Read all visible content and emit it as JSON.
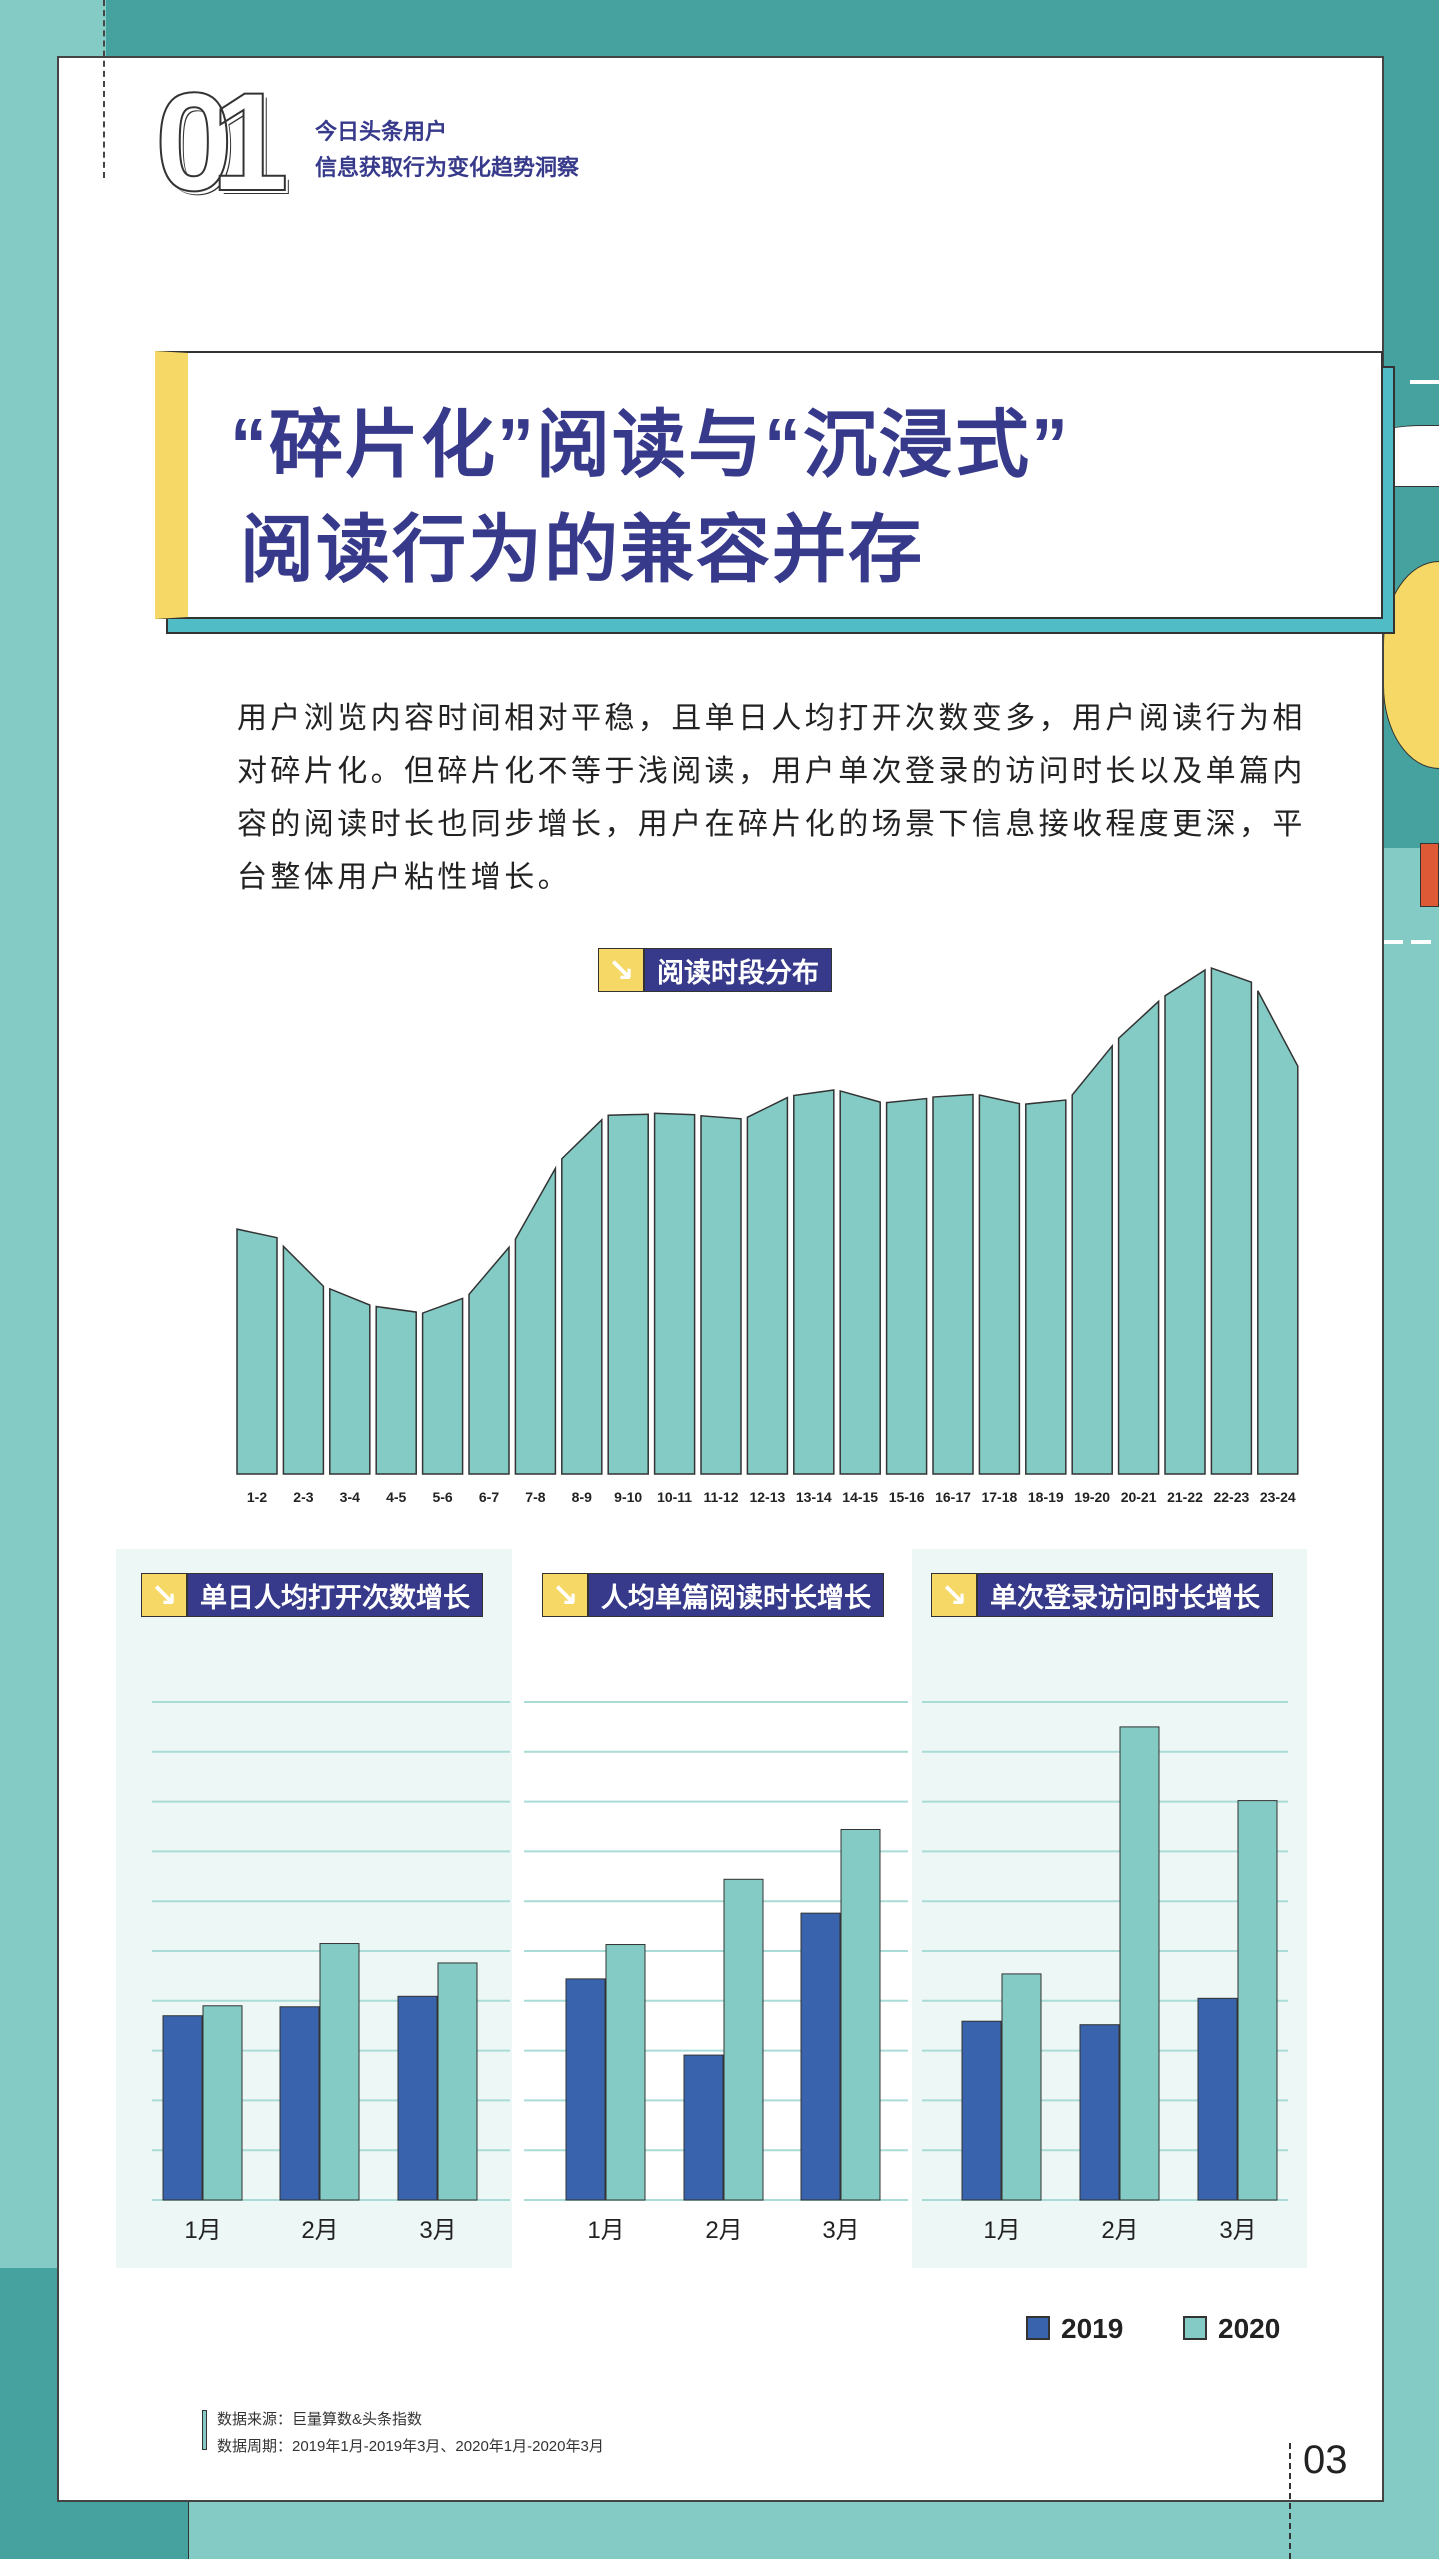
{
  "header": {
    "number": "01",
    "subtitle_line1": "今日头条用户",
    "subtitle_line2": "信息获取行为变化趋势洞察"
  },
  "title": {
    "line1": "“碎片化”阅读与“沉浸式”",
    "line2": "阅读行为的兼容并存"
  },
  "paragraph": "用户浏览内容时间相对平稳，且单日人均打开次数变多，用户阅读行为相对碎片化。但碎片化不等于浅阅读，用户单次登录的访问时长以及单篇内容的阅读时长也同步增长，用户在碎片化的场景下信息接收程度更深，平台整体用户粘性增长。",
  "icons": {
    "tag_icon": "arrow-down-right-icon"
  },
  "colors": {
    "navy": "#373a8a",
    "teal": "#84cbc5",
    "blue2019": "#3a63ae",
    "yellow": "#f5d865",
    "darkteal": "#45a29e"
  },
  "chart_data": [
    {
      "type": "bar",
      "title": "阅读时段分布",
      "categories": [
        "1-2",
        "2-3",
        "3-4",
        "4-5",
        "5-6",
        "6-7",
        "7-8",
        "8-9",
        "9-10",
        "10-11",
        "11-12",
        "12-13",
        "13-14",
        "14-15",
        "15-16",
        "16-17",
        "17-18",
        "18-19",
        "19-20",
        "20-21",
        "21-22",
        "22-23",
        "23-24"
      ],
      "values_start": [
        48.4,
        45.0,
        36.6,
        33.1,
        31.8,
        35.5,
        46.4,
        62.3,
        70.9,
        71.3,
        70.8,
        70.5,
        74.8,
        75.7,
        73.4,
        74.5,
        74.9,
        73.1,
        74.9,
        86.1,
        94.5,
        100,
        95.5
      ],
      "values_end": [
        46.7,
        37.1,
        33.4,
        32.0,
        34.7,
        44.8,
        60.4,
        70.0,
        71.1,
        71.0,
        70.2,
        74.4,
        75.9,
        73.5,
        74.2,
        75.0,
        73.2,
        73.9,
        84.6,
        93.4,
        99.6,
        97.2,
        80.6
      ],
      "ylim": [
        0,
        100
      ],
      "grid": false
    },
    {
      "type": "bar",
      "title": "单日人均打开次数增长",
      "categories": [
        "1月",
        "2月",
        "3月"
      ],
      "series": [
        {
          "name": "2019",
          "values": [
            3.7,
            3.88,
            4.09
          ]
        },
        {
          "name": "2020",
          "values": [
            3.9,
            5.15,
            4.76
          ]
        }
      ],
      "ylim": [
        0,
        10
      ],
      "grid": true
    },
    {
      "type": "bar",
      "title": "人均单篇阅读时长增长",
      "categories": [
        "1月",
        "2月",
        "3月"
      ],
      "series": [
        {
          "name": "2019",
          "values": [
            4.44,
            2.91,
            5.76
          ]
        },
        {
          "name": "2020",
          "values": [
            5.13,
            6.44,
            7.44
          ]
        }
      ],
      "ylim": [
        0,
        10
      ],
      "grid": true
    },
    {
      "type": "bar",
      "title": "单次登录访问时长增长",
      "categories": [
        "1月",
        "2月",
        "3月"
      ],
      "series": [
        {
          "name": "2019",
          "values": [
            3.59,
            3.52,
            4.05
          ]
        },
        {
          "name": "2020",
          "values": [
            4.54,
            9.5,
            8.02
          ]
        }
      ],
      "ylim": [
        0,
        10
      ],
      "grid": true
    }
  ],
  "legend": {
    "items": [
      "2019",
      "2020"
    ]
  },
  "footer": {
    "source": "数据来源：巨量算数&头条指数",
    "period": "数据周期：2019年1月-2019年3月、2020年1月-2020年3月",
    "page": "03"
  }
}
